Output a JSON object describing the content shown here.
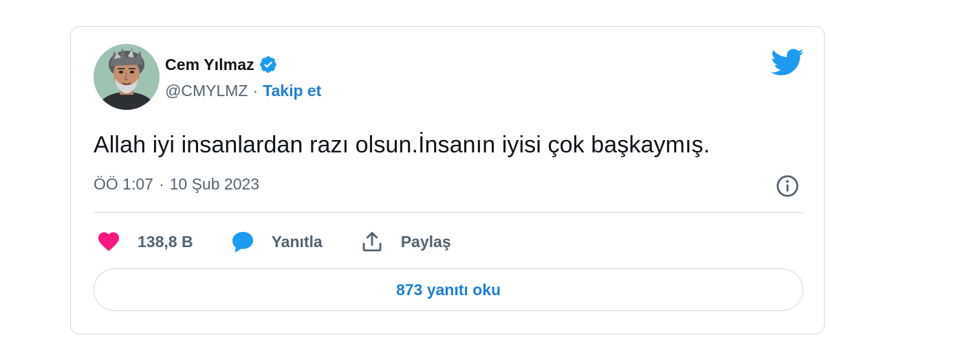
{
  "author": {
    "name": "Cem Yılmaz",
    "handle": "@CMYLMZ",
    "separator": "·",
    "follow_label": "Takip et",
    "verified": true
  },
  "tweet": {
    "text": "Allah iyi insanlardan razı olsun.İnsanın iyisi çok başkaymış.",
    "time": "ÖÖ 1:07",
    "meta_separator": "·",
    "date": "10 Şub 2023"
  },
  "actions": {
    "like_count": "138,8 B",
    "reply_label": "Yanıtla",
    "share_label": "Paylaş"
  },
  "replies_button": {
    "label": "873 yanıtı oku"
  },
  "icons": {
    "brand": "twitter-bird-icon",
    "verified": "verified-badge-icon",
    "info": "info-icon",
    "like": "heart-icon",
    "reply": "speech-bubble-icon",
    "share": "share-icon"
  },
  "colors": {
    "twitter_blue": "#1d9bf0",
    "link_blue": "#1d7fd6",
    "heart_pink": "#f91880",
    "text_primary": "#0f1419",
    "text_secondary": "#536471",
    "border": "#cfd9de"
  }
}
